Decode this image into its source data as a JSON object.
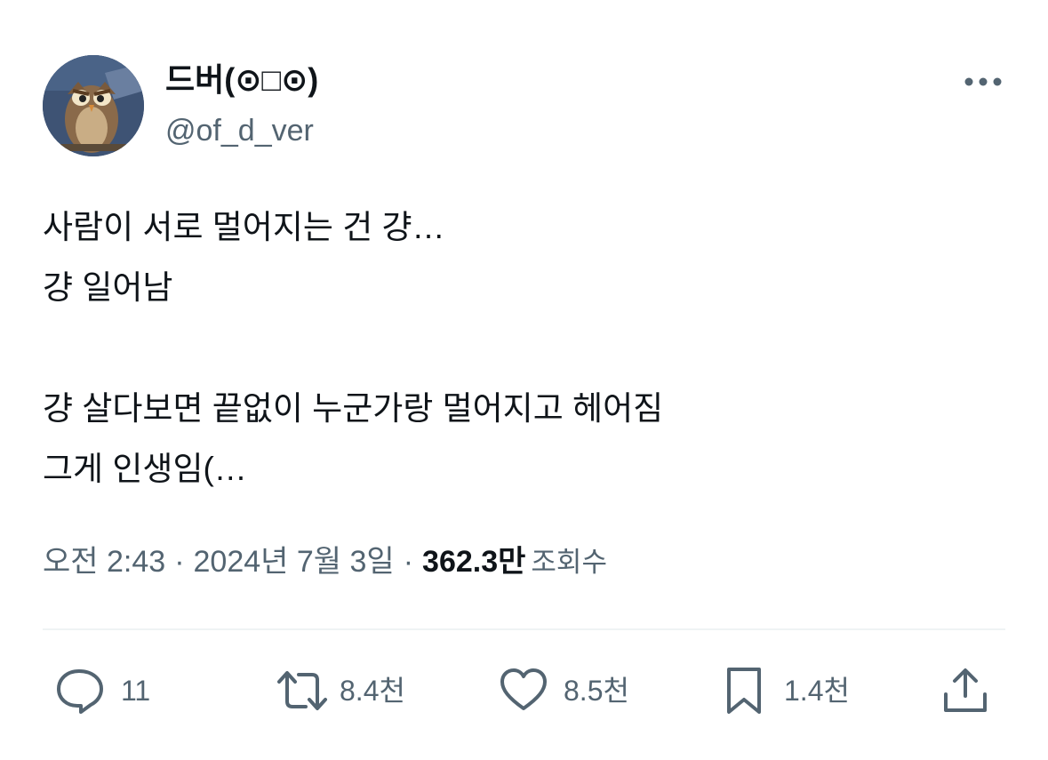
{
  "user": {
    "display_name": "드버(⊙□⊙)",
    "handle": "@of_d_ver",
    "avatar_icon": "owl-avatar-icon"
  },
  "tweet": {
    "lines": [
      "사람이 서로 멀어지는 건 걍…",
      "걍 일어남",
      "",
      "걍 살다보면 끝없이 누군가랑 멀어지고 헤어짐",
      "그게 인생임(…"
    ]
  },
  "meta": {
    "time": "오전 2:43",
    "separator": "·",
    "date": "2024년 7월 3일",
    "views_count": "362.3만",
    "views_label": "조회수"
  },
  "actions": {
    "reply_count": "11",
    "retweet_count": "8.4천",
    "like_count": "8.5천",
    "bookmark_count": "1.4천"
  },
  "colors": {
    "text_primary": "#0f1419",
    "text_secondary": "#536471",
    "divider": "#eff3f4"
  },
  "icons": {
    "more": "more-horizontal-icon",
    "reply": "reply-icon",
    "retweet": "retweet-icon",
    "like": "heart-icon",
    "bookmark": "bookmark-icon",
    "share": "share-icon"
  }
}
